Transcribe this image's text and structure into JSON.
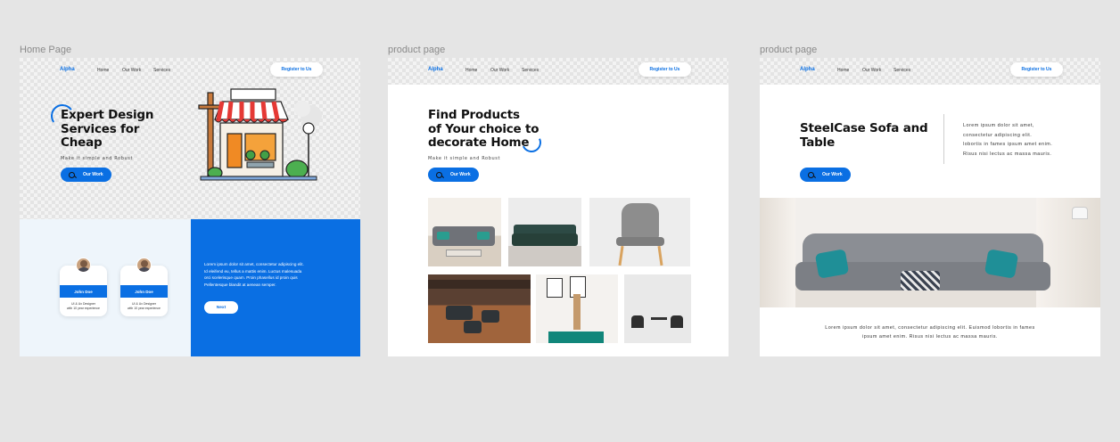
{
  "frames": [
    {
      "label": "Home Page",
      "nav": {
        "logo": "Alpha",
        "links": [
          "Home",
          "Our Work",
          "Services"
        ],
        "register": "Register to Us"
      },
      "hero": {
        "heading_lines": [
          "Expert Design",
          "Services for",
          "Cheap"
        ],
        "subtitle": "Make it simple and Robust",
        "button": "Our Work"
      },
      "team": [
        {
          "name": "John Doe",
          "desc_lines": [
            "UI & Ux Designer",
            "with 10 year experience"
          ]
        },
        {
          "name": "John Doe",
          "desc_lines": [
            "UI & Ux Designer",
            "with 10 year experience"
          ]
        }
      ],
      "promo": {
        "text_lines": [
          "Lorem ipsum dolor sit amet, consectetur adipiscing elit.",
          "Id eleifend eu, tellus a mattis enim. Luctus malesuada",
          "orci scelerisque quam. Proin phasellus id proin quis",
          "Pellentesque blandit at aenean semper."
        ],
        "button": "Next"
      }
    },
    {
      "label": "product page",
      "nav": {
        "logo": "Alpha",
        "links": [
          "Home",
          "Our Work",
          "Services"
        ],
        "register": "Register to Us"
      },
      "hero": {
        "heading_lines": [
          "Find Products",
          "of Your choice to",
          "decorate Home"
        ],
        "subtitle": "Make it simple and Robust",
        "button": "Our Work"
      }
    },
    {
      "label": "product page",
      "nav": {
        "logo": "Alpha",
        "links": [
          "Home",
          "Our Work",
          "Services"
        ],
        "register": "Register to Us"
      },
      "hero": {
        "heading_lines": [
          "SteelCase Sofa and",
          "Table"
        ],
        "button": "Our Work",
        "side_text_lines": [
          "Lorem ipsum dolor sit amet,",
          "consectetur adipiscing elit.",
          "lobortis in fames ipsum amet enim.",
          "Risus nisi lectus ac massa mauris."
        ]
      },
      "caption_lines": [
        "Lorem ipsum dolor sit amet, consectetur adipiscing elit. Euismod lobortis in fames",
        "ipsum amet enim. Risus nisi lectus ac massa mauris."
      ]
    }
  ],
  "colors": {
    "accent": "#0a6fe3",
    "canvas": "#e5e5e5"
  }
}
